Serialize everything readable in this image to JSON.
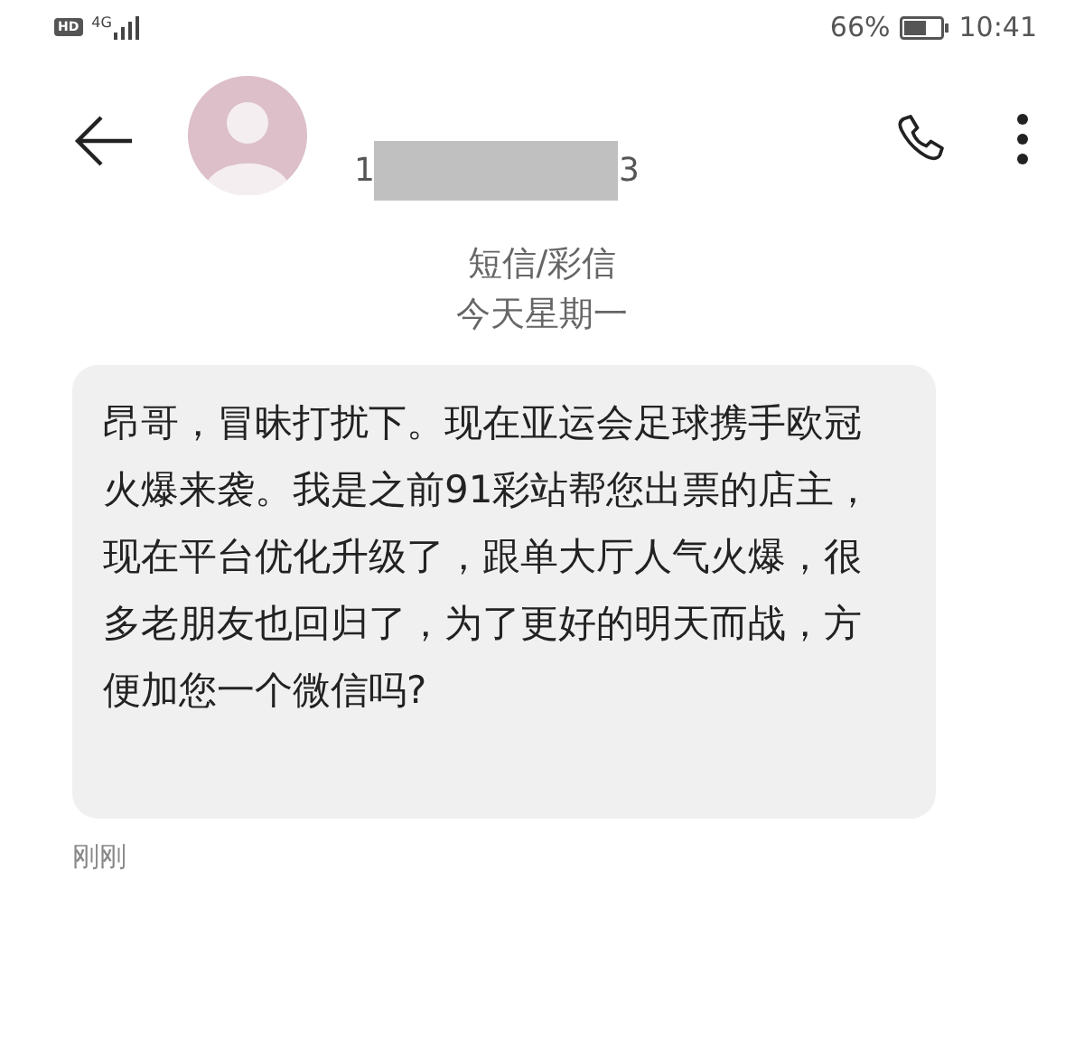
{
  "status_bar": {
    "hd": "HD",
    "network": "4G",
    "battery_percent": "66%",
    "time": "10:41"
  },
  "header": {
    "number_start": "1",
    "number_end": "3"
  },
  "thread_info": {
    "type": "短信/彩信",
    "date": "今天星期一"
  },
  "messages": [
    {
      "text": "昂哥，冒昧打扰下。现在亚运会足球携手欧冠火爆来袭。我是之前91彩站帮您出票的店主，现在平台优化升级了，跟单大厅人气火爆，很多老朋友也回归了，为了更好的明天而战，方便加您一个微信吗?",
      "time": "刚刚"
    }
  ]
}
